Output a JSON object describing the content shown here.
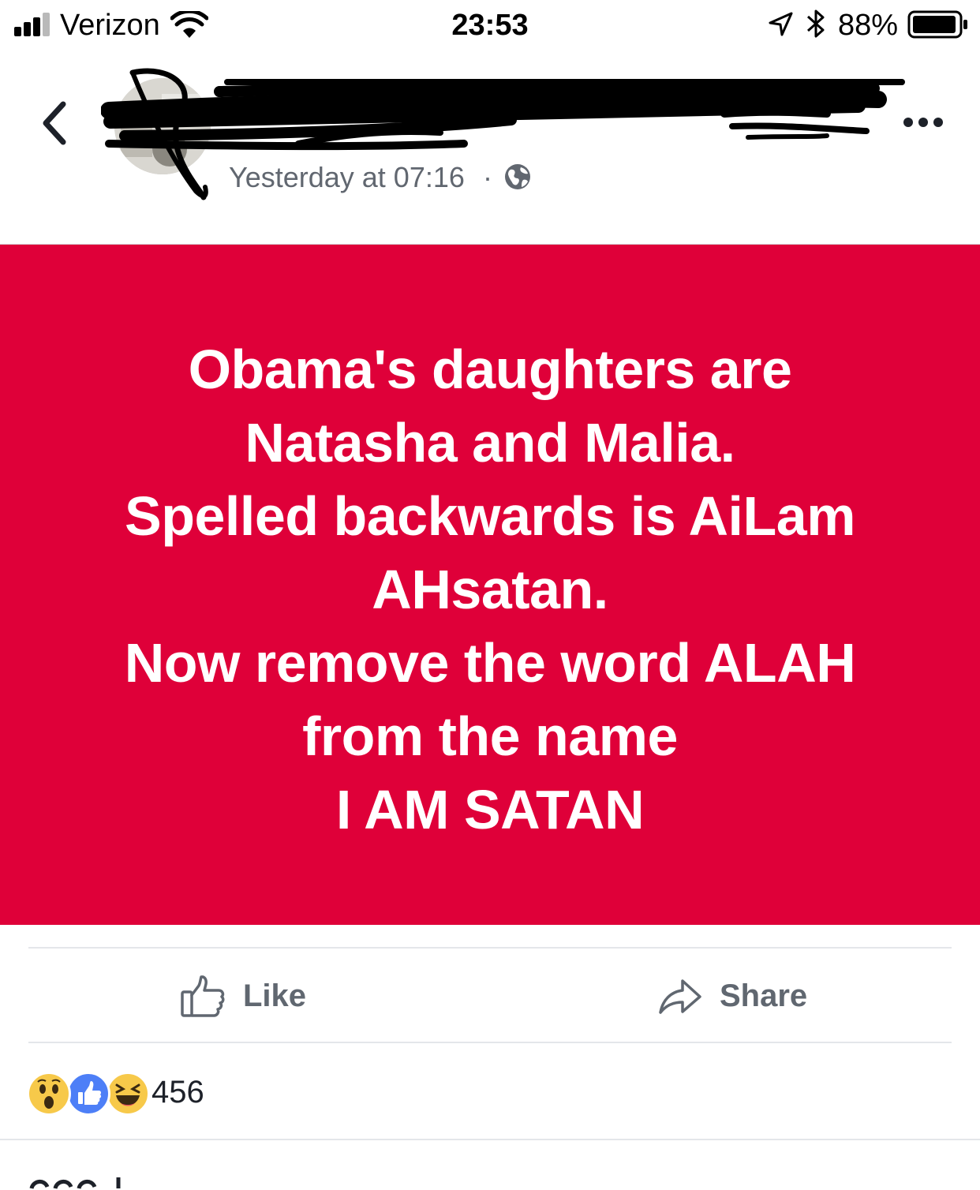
{
  "status_bar": {
    "carrier": "Verizon",
    "time": "23:53",
    "battery_percent": "88%",
    "signal_bars_filled": 3,
    "signal_bars_total": 5
  },
  "post": {
    "timestamp": "Yesterday at 07:16",
    "separator": "·",
    "audience_icon": "globe-icon",
    "image_background": "#df0039",
    "image_text_lines": [
      "Obama's daughters are",
      "Natasha and Malia.",
      "Spelled backwards is AiLam",
      "AHsatan.",
      "Now remove the word ALAH",
      "from the name",
      "I AM SATAN"
    ]
  },
  "actions": {
    "like_label": "Like",
    "share_label": "Share"
  },
  "reactions": {
    "icons": [
      "wow-reaction-icon",
      "like-reaction-icon",
      "haha-reaction-icon"
    ],
    "count": "456"
  },
  "colors": {
    "accent_blue": "#4267b2",
    "muted_text": "#606770",
    "reaction_yellow": "#f7c94a"
  }
}
